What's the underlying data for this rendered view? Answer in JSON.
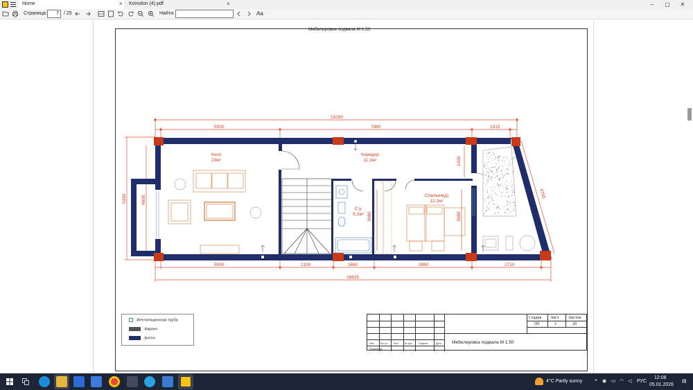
{
  "window": {
    "tabs": [
      {
        "label": "Home"
      },
      {
        "label": "Komolon (4).pdf"
      }
    ],
    "controls": {
      "minimize": "–",
      "maximize": "▢",
      "close": "✕"
    }
  },
  "toolbar": {
    "page_label": "Страница:",
    "page_value": "7",
    "page_total": "/ 25",
    "find_label": "Найти:",
    "find_value": "",
    "match_case_label": "Aa"
  },
  "drawing": {
    "title": "Мебелировка подвала    М 1:50",
    "rooms": [
      {
        "name": "Холл",
        "area": "23м²"
      },
      {
        "name": "Коридор",
        "area": "11.3м²"
      },
      {
        "name": "С.у.",
        "area": "5.1м²"
      },
      {
        "name": "Спальня(д)",
        "area": "12.1м²"
      }
    ],
    "dimensions": {
      "top_total": "15290",
      "top": [
        "5000",
        "7960",
        "1515"
      ],
      "bottom": [
        "5000",
        "2100",
        "1660",
        "3960",
        "2710"
      ],
      "bottom_total": "16615",
      "left_outer": "5190",
      "left_inner": "4600",
      "vertical": [
        "1400",
        "3080",
        "3080"
      ],
      "diagonal": "4765"
    },
    "colors": {
      "wall": "#1f2d6b",
      "column": "#c83a1a",
      "dimension": "#e05030",
      "furniture": "#d07a3c",
      "stairs": "#333333"
    }
  },
  "legend": {
    "items": [
      {
        "label": "-Вентиляционная труба"
      },
      {
        "label": "-Кирпич"
      },
      {
        "label": "-Бетон"
      }
    ]
  },
  "title_block": {
    "headers": [
      "Стадия",
      "Лист",
      "Листов"
    ],
    "values": [
      "ЭП",
      "2",
      "20"
    ],
    "columns": [
      "Изм.",
      "Кол.уч",
      "Лист",
      "№ док",
      "Подпись",
      "Дата"
    ],
    "developer_label": "Разработал",
    "sheet_title": "Мебелировка подвала    М 1:50"
  },
  "taskbar": {
    "weather": "4°C  Partly sunny",
    "language": "РУС",
    "time": "12:08",
    "date": "05.01.2026"
  }
}
